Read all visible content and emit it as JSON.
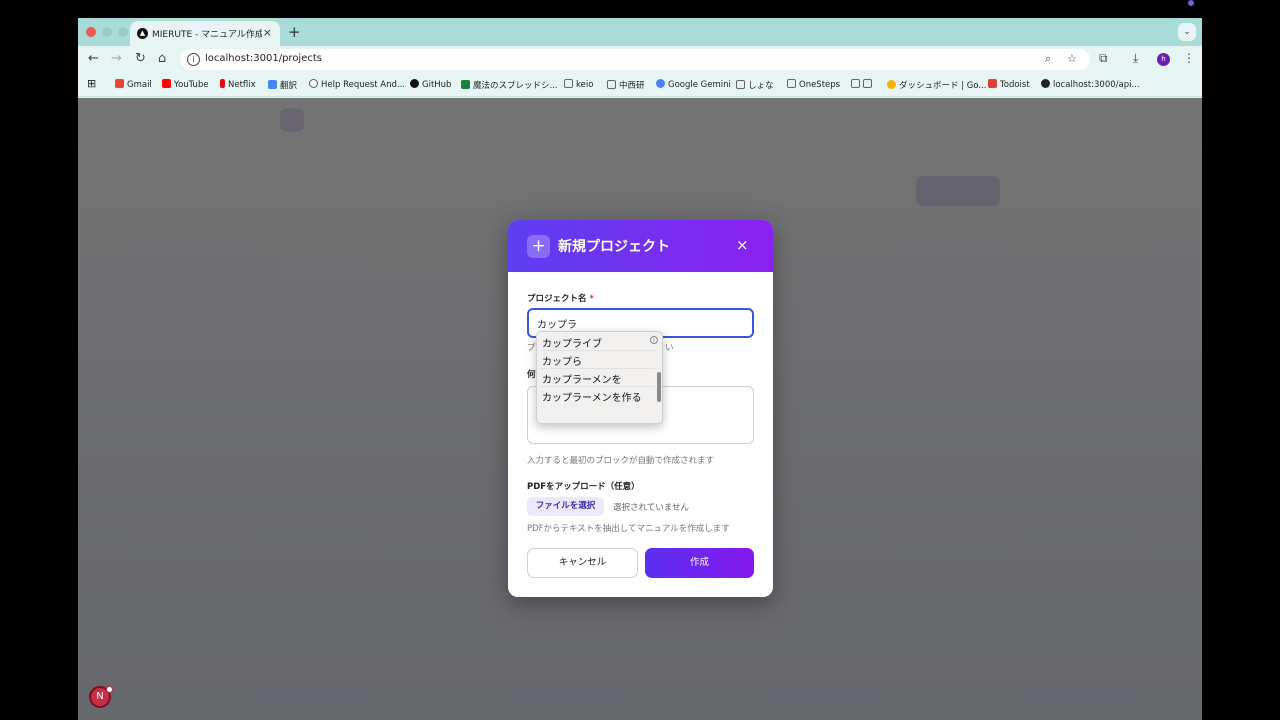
{
  "browser": {
    "tab_title": "MIERUTE - マニュアル作成ツ...",
    "tab_favicon": "▲",
    "close_tab": "×",
    "new_tab": "+",
    "url": "localhost:3001/projects"
  },
  "bookmarks": [
    {
      "label": "Gmail",
      "icon_color": "#ea4335"
    },
    {
      "label": "YouTube",
      "icon_color": "#ff0000"
    },
    {
      "label": "Netflix",
      "icon_color": "#e50914"
    },
    {
      "label": "翻訳",
      "icon_color": "#4285f4"
    },
    {
      "label": "Help Request And...",
      "icon_color": "#555555"
    },
    {
      "label": "GitHub",
      "icon_color": "#111111"
    },
    {
      "label": "魔法のスプレッドシ...",
      "icon_color": "#188038"
    },
    {
      "label": "keio",
      "icon_color": "#777777"
    },
    {
      "label": "中西研",
      "icon_color": "#777777"
    },
    {
      "label": "Google Gemini",
      "icon_color": "#4f7ef7"
    },
    {
      "label": "しょな",
      "icon_color": "#777777"
    },
    {
      "label": "OneSteps",
      "icon_color": "#777777"
    },
    {
      "label": "",
      "icon_color": "#777777"
    },
    {
      "label": "ダッシュボード | Go...",
      "icon_color": "#f4b400"
    },
    {
      "label": "Todoist",
      "icon_color": "#db4035"
    },
    {
      "label": "localhost:3000/api...",
      "icon_color": "#222222"
    }
  ],
  "modal": {
    "title": "新規プロジェクト",
    "plus": "+",
    "close": "×",
    "name_label": "プロジェクト名",
    "required_mark": "*",
    "name_value": "カップラ",
    "name_hint_start": "プ",
    "name_hint_end": "い",
    "desc_label_start": "何",
    "desc_hint": "入力すると最初のブロックが自動で作成されます",
    "pdf_label": "PDFをアップロード（任意）",
    "file_button": "ファイルを選択",
    "file_none": "選択されていません",
    "pdf_hint": "PDFからテキストを抽出してマニュアルを作成します",
    "cancel": "キャンセル",
    "create": "作成"
  },
  "ime_candidates": [
    "カップライブ",
    "カップら",
    "カップラーメンを",
    "カップラーメンを作る"
  ],
  "dev_badge": "N"
}
